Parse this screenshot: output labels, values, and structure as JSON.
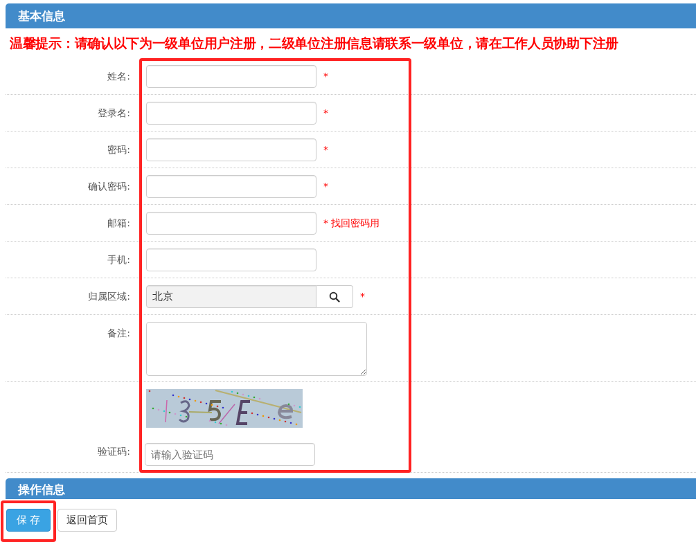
{
  "sections": [
    {
      "title": "基本信息"
    },
    {
      "title": "操作信息"
    }
  ],
  "notice": "温馨提示：请确认以下为一级单位用户注册，二级单位注册信息请联系一级单位，请在工作人员协助下注册",
  "fields": [
    {
      "kind": "text",
      "label": "姓名:",
      "required": true
    },
    {
      "kind": "text",
      "label": "登录名:",
      "required": true
    },
    {
      "kind": "text",
      "label": "密码:",
      "required": true
    },
    {
      "kind": "text",
      "label": "确认密码:",
      "required": true
    },
    {
      "kind": "text",
      "label": "邮箱:",
      "required": true,
      "hint": "找回密码用"
    },
    {
      "kind": "text",
      "label": "手机:",
      "required": false
    },
    {
      "kind": "lookup",
      "label": "归属区域:",
      "value": "北京",
      "required": true
    },
    {
      "kind": "textarea",
      "label": "备注:",
      "required": false
    },
    {
      "kind": "captcha",
      "label": "验证码:",
      "placeholder": "请输入验证码",
      "required": false
    }
  ],
  "required_mark": "*",
  "buttons": [
    {
      "label": "保 存",
      "kind": "primary"
    },
    {
      "label": "返回首页",
      "kind": "default"
    }
  ]
}
